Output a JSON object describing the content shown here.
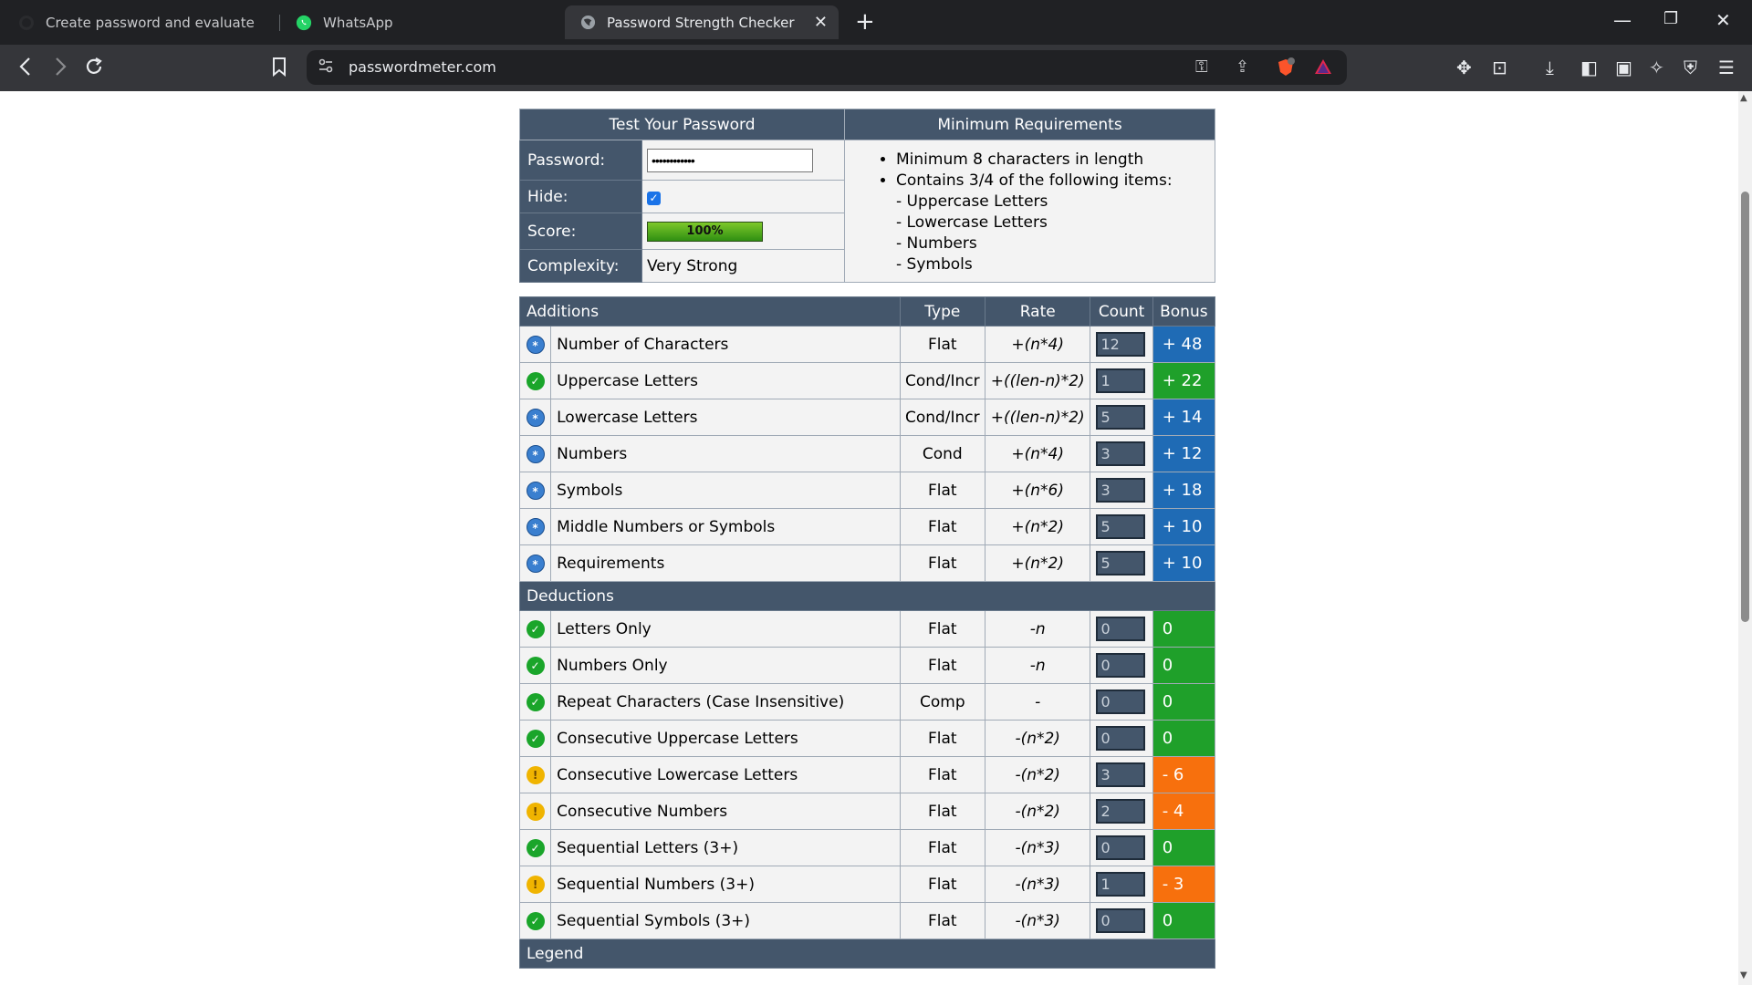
{
  "browser": {
    "tabs": [
      {
        "label": "Create password and evaluate",
        "icon": "openai-icon"
      },
      {
        "label": "WhatsApp",
        "icon": "whatsapp-icon"
      },
      {
        "label": "Password Strength Checker",
        "icon": "globe-icon",
        "active": true
      }
    ],
    "url": "passwordmeter.com"
  },
  "test": {
    "header": "Test Your Password",
    "password_label": "Password:",
    "password_value": "••••••••••••",
    "hide_label": "Hide:",
    "score_label": "Score:",
    "score_value": "100%",
    "score_fraction": 1.0,
    "complexity_label": "Complexity:",
    "complexity_value": "Very Strong"
  },
  "requirements": {
    "header": "Minimum Requirements",
    "item1": "Minimum 8 characters in length",
    "item2": "Contains 3/4 of the following items:",
    "sub1": "- Uppercase Letters",
    "sub2": "- Lowercase Letters",
    "sub3": "- Numbers",
    "sub4": "- Symbols"
  },
  "additions": {
    "header": "Additions",
    "col_type": "Type",
    "col_rate": "Rate",
    "col_count": "Count",
    "col_bonus": "Bonus",
    "rows": [
      {
        "status": "star",
        "name": "Number of Characters",
        "type": "Flat",
        "rate": "+(n*4)",
        "count": "12",
        "bonus": "+ 48",
        "bonus_color": "blue"
      },
      {
        "status": "ok",
        "name": "Uppercase Letters",
        "type": "Cond/Incr",
        "rate": "+((len-n)*2)",
        "count": "1",
        "bonus": "+ 22",
        "bonus_color": "green"
      },
      {
        "status": "star",
        "name": "Lowercase Letters",
        "type": "Cond/Incr",
        "rate": "+((len-n)*2)",
        "count": "5",
        "bonus": "+ 14",
        "bonus_color": "blue"
      },
      {
        "status": "star",
        "name": "Numbers",
        "type": "Cond",
        "rate": "+(n*4)",
        "count": "3",
        "bonus": "+ 12",
        "bonus_color": "blue"
      },
      {
        "status": "star",
        "name": "Symbols",
        "type": "Flat",
        "rate": "+(n*6)",
        "count": "3",
        "bonus": "+ 18",
        "bonus_color": "blue"
      },
      {
        "status": "star",
        "name": "Middle Numbers or Symbols",
        "type": "Flat",
        "rate": "+(n*2)",
        "count": "5",
        "bonus": "+ 10",
        "bonus_color": "blue"
      },
      {
        "status": "star",
        "name": "Requirements",
        "type": "Flat",
        "rate": "+(n*2)",
        "count": "5",
        "bonus": "+ 10",
        "bonus_color": "blue"
      }
    ]
  },
  "deductions": {
    "header": "Deductions",
    "rows": [
      {
        "status": "ok",
        "name": "Letters Only",
        "type": "Flat",
        "rate": "-n",
        "count": "0",
        "bonus": "0",
        "bonus_color": "green"
      },
      {
        "status": "ok",
        "name": "Numbers Only",
        "type": "Flat",
        "rate": "-n",
        "count": "0",
        "bonus": "0",
        "bonus_color": "green"
      },
      {
        "status": "ok",
        "name": "Repeat Characters (Case Insensitive)",
        "type": "Comp",
        "rate": "-",
        "count": "0",
        "bonus": "0",
        "bonus_color": "green"
      },
      {
        "status": "ok",
        "name": "Consecutive Uppercase Letters",
        "type": "Flat",
        "rate": "-(n*2)",
        "count": "0",
        "bonus": "0",
        "bonus_color": "green"
      },
      {
        "status": "warn",
        "name": "Consecutive Lowercase Letters",
        "type": "Flat",
        "rate": "-(n*2)",
        "count": "3",
        "bonus": "- 6",
        "bonus_color": "orange"
      },
      {
        "status": "warn",
        "name": "Consecutive Numbers",
        "type": "Flat",
        "rate": "-(n*2)",
        "count": "2",
        "bonus": "- 4",
        "bonus_color": "orange"
      },
      {
        "status": "ok",
        "name": "Sequential Letters (3+)",
        "type": "Flat",
        "rate": "-(n*3)",
        "count": "0",
        "bonus": "0",
        "bonus_color": "green"
      },
      {
        "status": "warn",
        "name": "Sequential Numbers (3+)",
        "type": "Flat",
        "rate": "-(n*3)",
        "count": "1",
        "bonus": "- 3",
        "bonus_color": "orange"
      },
      {
        "status": "ok",
        "name": "Sequential Symbols (3+)",
        "type": "Flat",
        "rate": "-(n*3)",
        "count": "0",
        "bonus": "0",
        "bonus_color": "green"
      }
    ]
  },
  "legend": {
    "header": "Legend"
  },
  "colors": {
    "blue": "#1f6bb5",
    "green": "#1fa02a",
    "orange": "#f7700d",
    "header_bg": "#44566b"
  }
}
